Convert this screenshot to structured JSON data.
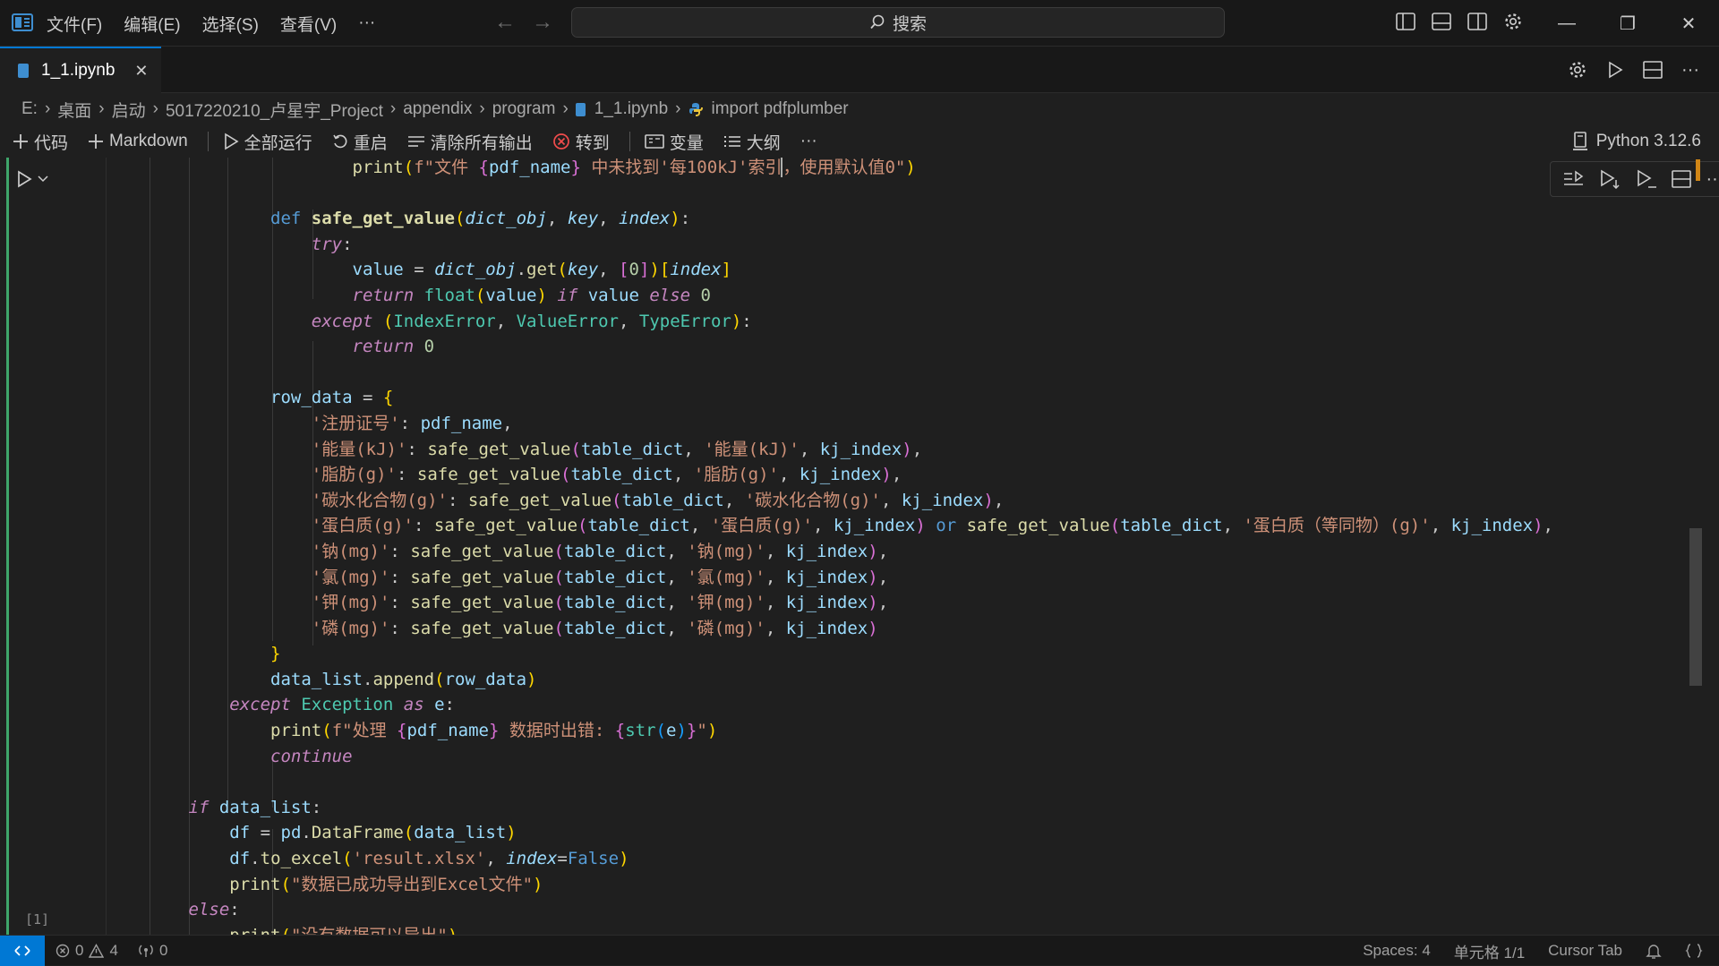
{
  "menu": [
    "文件(F)",
    "编辑(E)",
    "选择(S)",
    "查看(V)",
    "···"
  ],
  "search": {
    "label": "搜索"
  },
  "tab": {
    "name": "1_1.ipynb",
    "close": "✕"
  },
  "breadcrumb": [
    "E:",
    "桌面",
    "启动",
    "5017220210_卢星宇_Project",
    "appendix",
    "program",
    "1_1.ipynb",
    "import pdfplumber"
  ],
  "toolbar": {
    "code": "代码",
    "markdown": "Markdown",
    "run_all": "全部运行",
    "restart": "重启",
    "clear_outputs": "清除所有输出",
    "goto": "转到",
    "variables": "变量",
    "outline": "大纲",
    "more": "···",
    "kernel": "Python 3.12.6"
  },
  "cell": {
    "exec_count": "[1]"
  },
  "code_lines": [
    [
      [
        6,
        ""
      ],
      [
        "call",
        "print"
      ],
      [
        "br1",
        "("
      ],
      [
        "str",
        "f\"文件 "
      ],
      [
        "br2",
        "{"
      ],
      [
        "var",
        "pdf_name"
      ],
      [
        "br2",
        "}"
      ],
      [
        "str",
        " 中未找到'每100kJ'索引"
      ],
      [
        "strc",
        "，"
      ],
      [
        "str",
        "使用默认值0\""
      ],
      [
        "br1",
        ")"
      ]
    ],
    [],
    [
      [
        4,
        ""
      ],
      [
        "def",
        "def "
      ],
      [
        "fn",
        "safe_get_value"
      ],
      [
        "br1",
        "("
      ],
      [
        "prm",
        "dict_obj"
      ],
      [
        "pun",
        ", "
      ],
      [
        "prm",
        "key"
      ],
      [
        "pun",
        ", "
      ],
      [
        "prm",
        "index"
      ],
      [
        "br1",
        ")"
      ],
      [
        "pun",
        ":"
      ]
    ],
    [
      [
        5,
        ""
      ],
      [
        "kw",
        "try"
      ],
      [
        "pun",
        ":"
      ]
    ],
    [
      [
        6,
        ""
      ],
      [
        "var",
        "value"
      ],
      [
        "pun",
        " = "
      ],
      [
        "prm",
        "dict_obj"
      ],
      [
        "pun",
        "."
      ],
      [
        "call",
        "get"
      ],
      [
        "br1",
        "("
      ],
      [
        "prm",
        "key"
      ],
      [
        "pun",
        ", "
      ],
      [
        "br2",
        "["
      ],
      [
        "num",
        "0"
      ],
      [
        "br2",
        "]"
      ],
      [
        "br1",
        ")"
      ],
      [
        "br1",
        "["
      ],
      [
        "prm",
        "index"
      ],
      [
        "br1",
        "]"
      ]
    ],
    [
      [
        6,
        ""
      ],
      [
        "kw",
        "return "
      ],
      [
        "cls",
        "float"
      ],
      [
        "br1",
        "("
      ],
      [
        "var",
        "value"
      ],
      [
        "br1",
        ")"
      ],
      [
        "kw",
        " if "
      ],
      [
        "var",
        "value"
      ],
      [
        "kw",
        " else "
      ],
      [
        "num",
        "0"
      ]
    ],
    [
      [
        5,
        ""
      ],
      [
        "kw",
        "except "
      ],
      [
        "br1",
        "("
      ],
      [
        "cls",
        "IndexError"
      ],
      [
        "pun",
        ", "
      ],
      [
        "cls",
        "ValueError"
      ],
      [
        "pun",
        ", "
      ],
      [
        "cls",
        "TypeError"
      ],
      [
        "br1",
        ")"
      ],
      [
        "pun",
        ":"
      ]
    ],
    [
      [
        6,
        ""
      ],
      [
        "kw",
        "return "
      ],
      [
        "num",
        "0"
      ]
    ],
    [],
    [
      [
        4,
        ""
      ],
      [
        "var",
        "row_data"
      ],
      [
        "pun",
        " = "
      ],
      [
        "br1",
        "{"
      ]
    ],
    [
      [
        5,
        ""
      ],
      [
        "str",
        "'注册证号'"
      ],
      [
        "pun",
        ": "
      ],
      [
        "var",
        "pdf_name"
      ],
      [
        "pun",
        ","
      ]
    ],
    [
      [
        5,
        ""
      ],
      [
        "str",
        "'能量(kJ)'"
      ],
      [
        "pun",
        ": "
      ],
      [
        "call",
        "safe_get_value"
      ],
      [
        "br2",
        "("
      ],
      [
        "var",
        "table_dict"
      ],
      [
        "pun",
        ", "
      ],
      [
        "str",
        "'能量(kJ)'"
      ],
      [
        "pun",
        ", "
      ],
      [
        "var",
        "kj_index"
      ],
      [
        "br2",
        ")"
      ],
      [
        "pun",
        ","
      ]
    ],
    [
      [
        5,
        ""
      ],
      [
        "str",
        "'脂肪(g)'"
      ],
      [
        "pun",
        ": "
      ],
      [
        "call",
        "safe_get_value"
      ],
      [
        "br2",
        "("
      ],
      [
        "var",
        "table_dict"
      ],
      [
        "pun",
        ", "
      ],
      [
        "str",
        "'脂肪(g)'"
      ],
      [
        "pun",
        ", "
      ],
      [
        "var",
        "kj_index"
      ],
      [
        "br2",
        ")"
      ],
      [
        "pun",
        ","
      ]
    ],
    [
      [
        5,
        ""
      ],
      [
        "str",
        "'碳水化合物(g)'"
      ],
      [
        "pun",
        ": "
      ],
      [
        "call",
        "safe_get_value"
      ],
      [
        "br2",
        "("
      ],
      [
        "var",
        "table_dict"
      ],
      [
        "pun",
        ", "
      ],
      [
        "str",
        "'碳水化合物(g)'"
      ],
      [
        "pun",
        ", "
      ],
      [
        "var",
        "kj_index"
      ],
      [
        "br2",
        ")"
      ],
      [
        "pun",
        ","
      ]
    ],
    [
      [
        5,
        ""
      ],
      [
        "str",
        "'蛋白质(g)'"
      ],
      [
        "pun",
        ": "
      ],
      [
        "call",
        "safe_get_value"
      ],
      [
        "br2",
        "("
      ],
      [
        "var",
        "table_dict"
      ],
      [
        "pun",
        ", "
      ],
      [
        "str",
        "'蛋白质(g)'"
      ],
      [
        "pun",
        ", "
      ],
      [
        "var",
        "kj_index"
      ],
      [
        "br2",
        ")"
      ],
      [
        "def",
        " or "
      ],
      [
        "call",
        "safe_get_value"
      ],
      [
        "br2",
        "("
      ],
      [
        "var",
        "table_dict"
      ],
      [
        "pun",
        ", "
      ],
      [
        "str",
        "'蛋白质（等同物）(g)'"
      ],
      [
        "pun",
        ", "
      ],
      [
        "var",
        "kj_index"
      ],
      [
        "br2",
        ")"
      ],
      [
        "pun",
        ","
      ]
    ],
    [
      [
        5,
        ""
      ],
      [
        "str",
        "'钠(mg)'"
      ],
      [
        "pun",
        ": "
      ],
      [
        "call",
        "safe_get_value"
      ],
      [
        "br2",
        "("
      ],
      [
        "var",
        "table_dict"
      ],
      [
        "pun",
        ", "
      ],
      [
        "str",
        "'钠(mg)'"
      ],
      [
        "pun",
        ", "
      ],
      [
        "var",
        "kj_index"
      ],
      [
        "br2",
        ")"
      ],
      [
        "pun",
        ","
      ]
    ],
    [
      [
        5,
        ""
      ],
      [
        "str",
        "'氯(mg)'"
      ],
      [
        "pun",
        ": "
      ],
      [
        "call",
        "safe_get_value"
      ],
      [
        "br2",
        "("
      ],
      [
        "var",
        "table_dict"
      ],
      [
        "pun",
        ", "
      ],
      [
        "str",
        "'氯(mg)'"
      ],
      [
        "pun",
        ", "
      ],
      [
        "var",
        "kj_index"
      ],
      [
        "br2",
        ")"
      ],
      [
        "pun",
        ","
      ]
    ],
    [
      [
        5,
        ""
      ],
      [
        "str",
        "'钾(mg)'"
      ],
      [
        "pun",
        ": "
      ],
      [
        "call",
        "safe_get_value"
      ],
      [
        "br2",
        "("
      ],
      [
        "var",
        "table_dict"
      ],
      [
        "pun",
        ", "
      ],
      [
        "str",
        "'钾(mg)'"
      ],
      [
        "pun",
        ", "
      ],
      [
        "var",
        "kj_index"
      ],
      [
        "br2",
        ")"
      ],
      [
        "pun",
        ","
      ]
    ],
    [
      [
        5,
        ""
      ],
      [
        "str",
        "'磷(mg)'"
      ],
      [
        "pun",
        ": "
      ],
      [
        "call",
        "safe_get_value"
      ],
      [
        "br2",
        "("
      ],
      [
        "var",
        "table_dict"
      ],
      [
        "pun",
        ", "
      ],
      [
        "str",
        "'磷(mg)'"
      ],
      [
        "pun",
        ", "
      ],
      [
        "var",
        "kj_index"
      ],
      [
        "br2",
        ")"
      ]
    ],
    [
      [
        4,
        ""
      ],
      [
        "br1",
        "}"
      ]
    ],
    [
      [
        4,
        ""
      ],
      [
        "var",
        "data_list"
      ],
      [
        "pun",
        "."
      ],
      [
        "call",
        "append"
      ],
      [
        "br1",
        "("
      ],
      [
        "var",
        "row_data"
      ],
      [
        "br1",
        ")"
      ]
    ],
    [
      [
        3,
        ""
      ],
      [
        "kw",
        "except "
      ],
      [
        "cls",
        "Exception"
      ],
      [
        "kw",
        " as "
      ],
      [
        "var",
        "e"
      ],
      [
        "pun",
        ":"
      ]
    ],
    [
      [
        4,
        ""
      ],
      [
        "call",
        "print"
      ],
      [
        "br1",
        "("
      ],
      [
        "str",
        "f\"处理 "
      ],
      [
        "br2",
        "{"
      ],
      [
        "var",
        "pdf_name"
      ],
      [
        "br2",
        "}"
      ],
      [
        "str",
        " 数据时出错: "
      ],
      [
        "br2",
        "{"
      ],
      [
        "cls",
        "str"
      ],
      [
        "br3",
        "("
      ],
      [
        "var",
        "e"
      ],
      [
        "br3",
        ")"
      ],
      [
        "br2",
        "}"
      ],
      [
        "str",
        "\""
      ],
      [
        "br1",
        ")"
      ]
    ],
    [
      [
        4,
        ""
      ],
      [
        "kw",
        "continue"
      ]
    ],
    [],
    [
      [
        2,
        ""
      ],
      [
        "kw",
        "if "
      ],
      [
        "var",
        "data_list"
      ],
      [
        "pun",
        ":"
      ]
    ],
    [
      [
        3,
        ""
      ],
      [
        "var",
        "df"
      ],
      [
        "pun",
        " = "
      ],
      [
        "var",
        "pd"
      ],
      [
        "pun",
        "."
      ],
      [
        "call",
        "DataFrame"
      ],
      [
        "br1",
        "("
      ],
      [
        "var",
        "data_list"
      ],
      [
        "br1",
        ")"
      ]
    ],
    [
      [
        3,
        ""
      ],
      [
        "var",
        "df"
      ],
      [
        "pun",
        "."
      ],
      [
        "call",
        "to_excel"
      ],
      [
        "br1",
        "("
      ],
      [
        "str",
        "'result.xlsx'"
      ],
      [
        "pun",
        ", "
      ],
      [
        "prm",
        "index"
      ],
      [
        "pun",
        "="
      ],
      [
        "def",
        "False"
      ],
      [
        "br1",
        ")"
      ]
    ],
    [
      [
        3,
        ""
      ],
      [
        "call",
        "print"
      ],
      [
        "br1",
        "("
      ],
      [
        "str",
        "\"数据已成功导出到Excel文件\""
      ],
      [
        "br1",
        ")"
      ]
    ],
    [
      [
        2,
        ""
      ],
      [
        "kw",
        "else"
      ],
      [
        "pun",
        ":"
      ]
    ],
    [
      [
        3,
        ""
      ],
      [
        "call",
        "print"
      ],
      [
        "br1",
        "("
      ],
      [
        "str",
        "\"没有数据可以导出\""
      ],
      [
        "br1",
        ")"
      ]
    ]
  ],
  "status": {
    "errors": "0",
    "warnings": "4",
    "ports": "0",
    "spaces": "Spaces: 4",
    "cell": "单元格 1/1",
    "cursor_tab": "Cursor Tab"
  },
  "colors": {
    "accent": "#0078d4",
    "cell_bar": "#3fa56a",
    "background": "#1f1f1f"
  }
}
